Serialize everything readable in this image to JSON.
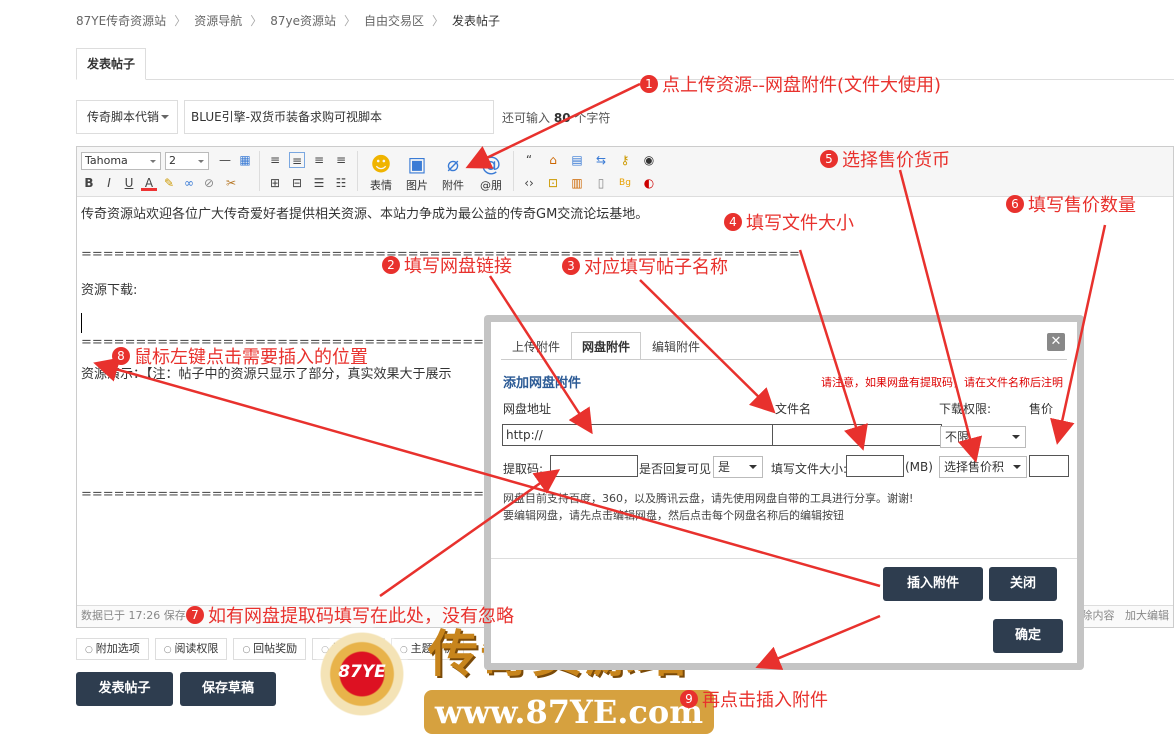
{
  "breadcrumb": [
    "87YE传奇资源站",
    "资源导航",
    "87ye资源站",
    "自由交易区",
    "发表帖子"
  ],
  "page_tab": "发表帖子",
  "title_row": {
    "type_select": "传奇脚本代销",
    "title_value": "BLUE引擎-双货币装备求购可视脚本",
    "remain_prefix": "还可输入",
    "remain_count": "80",
    "remain_suffix": "个字符"
  },
  "toolbar": {
    "font": "Tahoma",
    "size": "2",
    "emoji": "表情",
    "image": "图片",
    "attach": "附件",
    "mention": "@朋"
  },
  "content": {
    "line1": "传奇资源站欢迎各位广大传奇爱好者提供相关资源、本站力争成为最公益的传奇GM交流论坛基地。",
    "divider": "==================================================================",
    "download": "资源下载:",
    "demo": "资源演示：【注：帖子中的资源只显示了部分，真实效果大于展示"
  },
  "status": {
    "left": "数据已于 17:26 保存",
    "right_clear": "清除内容",
    "right_enlarge": "加大编辑"
  },
  "options": [
    "附加选项",
    "阅读权限",
    "回帖奖励",
    "抢楼主题",
    "主题售价"
  ],
  "buttons": {
    "submit": "发表帖子",
    "draft": "保存草稿"
  },
  "dialog": {
    "tabs": [
      "上传附件",
      "网盘附件",
      "编辑附件"
    ],
    "heading": "添加网盘附件",
    "note": "请注意，如果网盘有提取码，请在文件名称后注明",
    "col_url": "网盘地址",
    "col_name": "文件名",
    "col_perm": "下载权限:",
    "col_price": "售价",
    "url_value": "http://",
    "perm_value": "不限",
    "code_label": "提取码:",
    "reply_label": "是否回复可见",
    "reply_value": "是",
    "size_label": "填写文件大小:",
    "size_unit": "(MB)",
    "currency_value": "选择售价积",
    "help1": "网盘目前支持百度，360，以及腾讯云盘，请先使用网盘自带的工具进行分享。谢谢!",
    "help2": "要编辑网盘，请先点击编辑网盘，然后点击每个网盘名称后的编辑按钮",
    "insert": "插入附件",
    "close": "关闭",
    "confirm": "确定"
  },
  "annotations": [
    {
      "n": "1",
      "text": "点上传资源--网盘附件(文件大使用)"
    },
    {
      "n": "2",
      "text": "填写网盘链接"
    },
    {
      "n": "3",
      "text": "对应填写帖子名称"
    },
    {
      "n": "4",
      "text": "填写文件大小"
    },
    {
      "n": "5",
      "text": "选择售价货币"
    },
    {
      "n": "6",
      "text": "填写售价数量"
    },
    {
      "n": "7",
      "text": "如有网盘提取码填写在此处，没有忽略"
    },
    {
      "n": "8",
      "text": "鼠标左键点击需要插入的位置"
    },
    {
      "n": "9",
      "text": "再点击插入附件"
    }
  ],
  "watermark": {
    "badge": "87YE",
    "title": "传奇资源站",
    "url": "www.87YE.com"
  },
  "colors": {
    "dark_button": "#2e3d4f",
    "annotation": "#e8312d",
    "dialog_heading": "#2b5a95"
  }
}
